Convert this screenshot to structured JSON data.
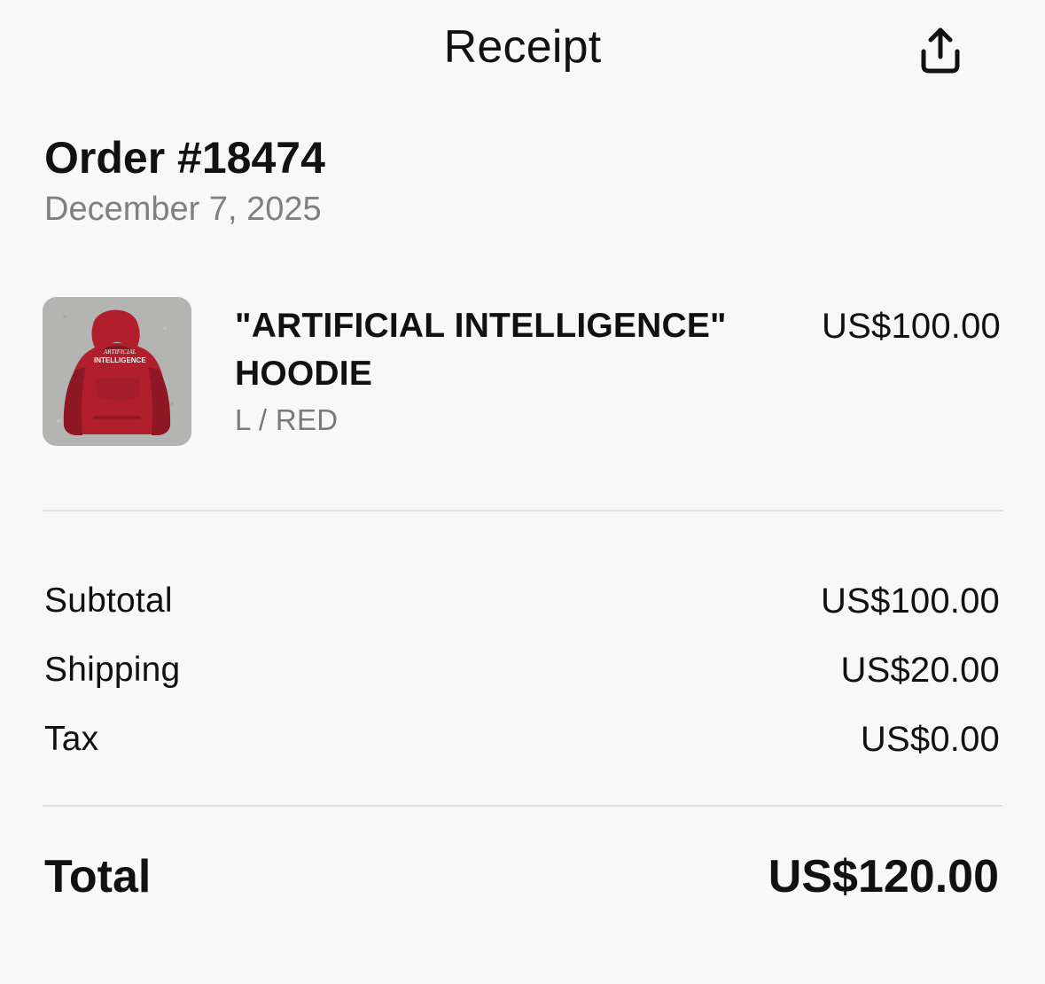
{
  "header": {
    "title": "Receipt",
    "share_icon": "share-icon"
  },
  "order": {
    "title": "Order #18474",
    "date": "December 7, 2025"
  },
  "item": {
    "name": "\"ARTIFICIAL INTELLIGENCE\" HOODIE",
    "variant": "L / RED",
    "price": "US$100.00",
    "image_text_line1": "ARTIFICIAL",
    "image_text_line2": "INTELLIGENCE",
    "image_colors": {
      "background": "#b4b4b2",
      "hoodie": "#b11f2d",
      "hoodie_shadow": "#8d1824"
    }
  },
  "summary": {
    "subtotal_label": "Subtotal",
    "subtotal_value": "US$100.00",
    "shipping_label": "Shipping",
    "shipping_value": "US$20.00",
    "tax_label": "Tax",
    "tax_value": "US$0.00"
  },
  "total": {
    "label": "Total",
    "value": "US$120.00"
  },
  "colors": {
    "background": "#f8f8f8",
    "primary_text": "#111111",
    "secondary_text": "#808080",
    "divider": "#e0e0e0"
  }
}
